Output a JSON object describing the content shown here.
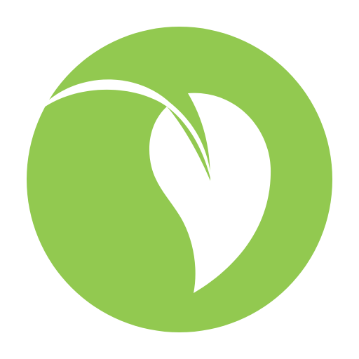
{
  "logo": {
    "icon": "leaf-circle-logo-icon",
    "colors": {
      "circle": "#92C950",
      "leaf": "#FFFFFF",
      "background": "#FFFFFF"
    }
  }
}
